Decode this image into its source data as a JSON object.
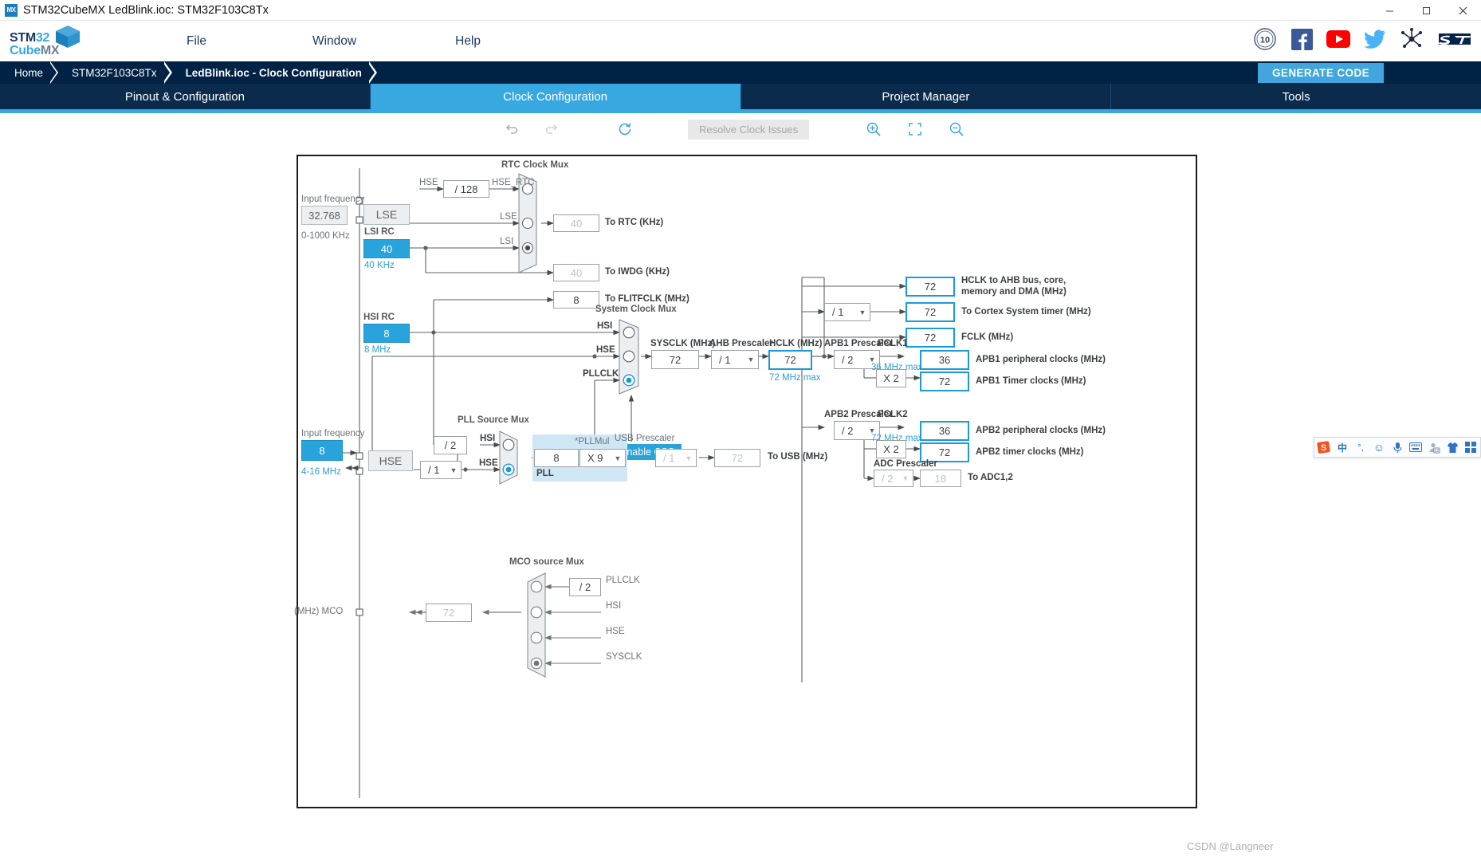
{
  "window": {
    "title": "STM32CubeMX LedBlink.ioc: STM32F103C8Tx",
    "app_icon": "MX",
    "minimize": "–",
    "maximize": "❐",
    "close": "×"
  },
  "logo": {
    "line1_a": "STM",
    "line1_b": "32",
    "line2_a": "Cube",
    "line2_b": "MX"
  },
  "menu": {
    "file": "File",
    "window": "Window",
    "help": "Help"
  },
  "social": {
    "anniversary": "10",
    "facebook": "facebook-icon",
    "youtube": "youtube-icon",
    "twitter": "twitter-icon",
    "community": "community-icon",
    "st": "st-logo-icon"
  },
  "breadcrumb": {
    "home": "Home",
    "device": "STM32F103C8Tx",
    "current": "LedBlink.ioc - Clock Configuration",
    "generate_code": "GENERATE CODE"
  },
  "tabs": [
    {
      "label": "Pinout & Configuration",
      "active": false
    },
    {
      "label": "Clock Configuration",
      "active": true
    },
    {
      "label": "Project Manager",
      "active": false
    },
    {
      "label": "Tools",
      "active": false
    }
  ],
  "toolbar": {
    "undo": "undo-icon",
    "redo": "redo-icon",
    "reset": "reset-icon",
    "resolve_label": "Resolve Clock Issues",
    "zoom_in": "zoom-in-icon",
    "fit": "fit-to-screen-icon",
    "zoom_out": "zoom-out-icon"
  },
  "diagram": {
    "lse": {
      "input_frequency_label": "Input frequency",
      "value": "32.768",
      "range": "0-1000 KHz",
      "osc_label": "LSE"
    },
    "lsi": {
      "title": "LSI RC",
      "value": "40",
      "unit": "40 KHz"
    },
    "hse_div": {
      "input_label": "HSE",
      "value": "/ 128",
      "output_label": "HSE_RTC"
    },
    "rtc_mux": {
      "title": "RTC Clock Mux",
      "inputs": [
        "HSE_RTC",
        "LSE",
        "LSI"
      ],
      "selected": "LSI"
    },
    "outputs_left": [
      {
        "value": "40",
        "label": "To RTC (KHz)",
        "dim": true
      },
      {
        "value": "40",
        "label": "To IWDG (KHz)",
        "dim": true
      },
      {
        "value": "8",
        "label": "To FLITFCLK (MHz)",
        "dim": false
      }
    ],
    "hsi": {
      "title": "HSI RC",
      "value": "8",
      "unit": "8 MHz"
    },
    "hse": {
      "input_frequency_label": "Input frequency",
      "value": "8",
      "range": "4-16 MHz",
      "osc_label": "HSE"
    },
    "system_clock_mux": {
      "title": "System Clock Mux",
      "inputs": [
        "HSI",
        "HSE",
        "PLLCLK"
      ],
      "selected": "PLLCLK"
    },
    "enable_css": "Enable CSS",
    "sysclk": {
      "label": "SYSCLK (MHz)",
      "value": "72"
    },
    "ahb_prescaler": {
      "label": "AHB Prescaler",
      "value": "/ 1"
    },
    "hclk": {
      "label": "HCLK (MHz)",
      "value": "72",
      "max": "72 MHz max"
    },
    "cortex_prescaler": {
      "value": "/ 1"
    },
    "ahb_outputs": [
      {
        "value": "72",
        "label": "HCLK to AHB bus, core,",
        "label2": "memory and DMA (MHz)"
      },
      {
        "value": "72",
        "label": "To Cortex System timer (MHz)",
        "label2": ""
      },
      {
        "value": "72",
        "label": "FCLK (MHz)",
        "label2": ""
      }
    ],
    "apb1": {
      "prescaler_label": "APB1 Prescaler",
      "prescaler_value": "/ 2",
      "pclk_label": "PCLK1",
      "max": "36 MHz max",
      "multiplier": "X 2",
      "outputs": [
        {
          "value": "36",
          "label": "APB1 peripheral clocks (MHz)"
        },
        {
          "value": "72",
          "label": "APB1 Timer clocks (MHz)"
        }
      ]
    },
    "apb2": {
      "prescaler_label": "APB2 Prescaler",
      "prescaler_value": "/ 2",
      "pclk_label": "PCLK2",
      "max": "72 MHz max",
      "multiplier": "X 2",
      "outputs": [
        {
          "value": "36",
          "label": "APB2 peripheral clocks (MHz)"
        },
        {
          "value": "72",
          "label": "APB2 timer clocks (MHz)"
        }
      ]
    },
    "adc": {
      "prescaler_label": "ADC Prescaler",
      "prescaler_value": "/ 2",
      "value": "18",
      "label": "To ADC1,2"
    },
    "pll_source_mux": {
      "title": "PLL Source Mux",
      "hsi_div": "/ 2",
      "inputs": [
        "HSI",
        "HSE"
      ],
      "selected": "HSE",
      "hse_prescaler": "/ 1"
    },
    "pll": {
      "region_label": "PLL",
      "mul_label": "*PLLMul",
      "input_value": "8",
      "mul_value": "X 9"
    },
    "usb": {
      "prescaler_label": "USB Prescaler",
      "prescaler_value": "/ 1",
      "value": "72",
      "label": "To USB (MHz)"
    },
    "mco": {
      "title": "MCO source Mux",
      "pllclk_div": "/ 2",
      "inputs": [
        "PLLCLK",
        "HSI",
        "HSE",
        "SYSCLK"
      ],
      "selected": "SYSCLK",
      "output_value": "72",
      "output_label": "(MHz) MCO"
    }
  },
  "ime": {
    "logo": "sogou-icon",
    "mode": "中",
    "punct": "°,",
    "emoji": "☺",
    "mic": "mic-icon",
    "keyboard": "keyboard-icon",
    "user": "user-icon",
    "skin": "skin-icon",
    "apps": "apps-icon"
  },
  "watermark": "CSDN @Langneer",
  "colors": {
    "accent": "#38a8e0",
    "dark_nav": "#002244",
    "tab_inactive": "#0b2b4d",
    "highlight_blue": "#29a3dc",
    "pll_region": "#cfe7f5"
  }
}
